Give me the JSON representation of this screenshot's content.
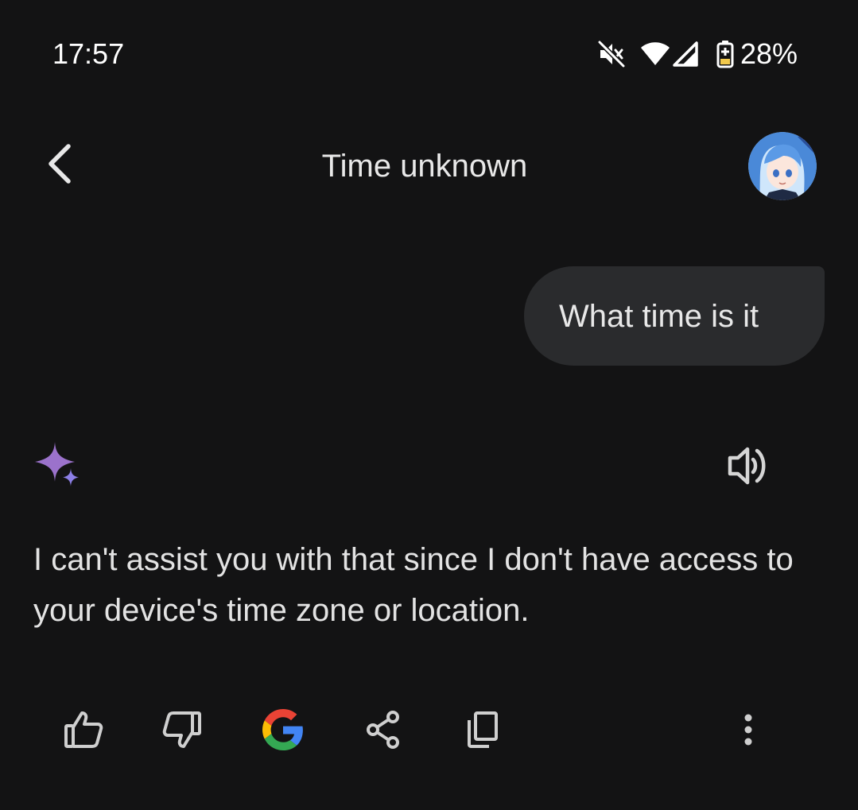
{
  "status_bar": {
    "time": "17:57",
    "battery_percent": "28%",
    "icons": [
      "mute-icon",
      "wifi-icon",
      "cell-signal-icon",
      "battery-charging-icon"
    ]
  },
  "header": {
    "title": "Time unknown",
    "back_icon": "back-arrow-icon",
    "avatar": "user-avatar"
  },
  "conversation": {
    "user_message": "What time is it",
    "assistant_icon": "sparkle-icon",
    "assistant_response": "I can't assist you with that since I don't have access to your device's time zone or location.",
    "speaker_icon": "speaker-icon"
  },
  "actions": [
    {
      "name": "thumbs-up-icon"
    },
    {
      "name": "thumbs-down-icon"
    },
    {
      "name": "google-icon"
    },
    {
      "name": "share-icon"
    },
    {
      "name": "copy-icon"
    },
    {
      "name": "more-options-icon"
    }
  ],
  "colors": {
    "background": "#131314",
    "bubble": "#2a2b2d",
    "sparkle": "#9b72cb",
    "google_blue": "#4285F4",
    "google_red": "#EA4335",
    "google_yellow": "#FBBC05",
    "google_green": "#34A853"
  }
}
